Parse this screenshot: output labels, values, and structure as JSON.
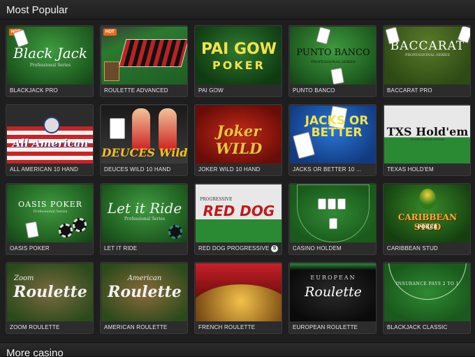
{
  "sections": {
    "most_popular": "Most Popular",
    "more_casino": "More casino"
  },
  "badges": {
    "hot": "HOT",
    "s": "S"
  },
  "games": [
    {
      "label": "BLACKJACK PRO",
      "logo": "Black Jack",
      "sub": "Professional Series"
    },
    {
      "label": "ROULETTE ADVANCED",
      "logo": "",
      "sub": ""
    },
    {
      "label": "PAI GOW",
      "logo": "PAI GOW",
      "sub": "POKER"
    },
    {
      "label": "PUNTO BANCO",
      "logo": "PUNTO BANCO",
      "sub": "PROFESSIONAL SERIES"
    },
    {
      "label": "BACCARAT PRO",
      "logo": "BACCARAT",
      "sub": "PROFESSIONAL SERIES"
    },
    {
      "label": "ALL AMERICAN 10 HAND",
      "logo": "All American",
      "sub": "100 Hand"
    },
    {
      "label": "DEUCES WILD 10 HAND",
      "logo": "DEUCES Wild",
      "sub": ""
    },
    {
      "label": "JOKER WILD 10 HAND",
      "logo": "Joker WILD",
      "sub": ""
    },
    {
      "label": "JACKS OR BETTER 10 ...",
      "logo": "JACKS OR BETTER",
      "sub": ""
    },
    {
      "label": "TEXAS HOLD'EM",
      "logo": "TXS Hold'em",
      "sub": "Professional Series"
    },
    {
      "label": "OASIS POKER",
      "logo": "OASIS POKER",
      "sub": "Professional Series"
    },
    {
      "label": "LET IT RIDE",
      "logo": "Let it Ride",
      "sub": "Professional Series"
    },
    {
      "label": "RED DOG PROGRESSIVE",
      "logo": "RED DOG",
      "sub": "PROGRESSIVE"
    },
    {
      "label": "CASINO HOLDEM",
      "logo": "",
      "sub": ""
    },
    {
      "label": "CARIBBEAN STUD",
      "logo": "CARIBBEAN STUD",
      "sub": "POKER"
    },
    {
      "label": "ZOOM ROULETTE",
      "logo": "Roulette",
      "sub": "Zoom"
    },
    {
      "label": "AMERICAN ROULETTE",
      "logo": "Roulette",
      "sub": "American"
    },
    {
      "label": "FRENCH ROULETTE",
      "logo": "",
      "sub": ""
    },
    {
      "label": "EUROPEAN ROULETTE",
      "logo": "Roulette",
      "sub": "EUROPEAN"
    },
    {
      "label": "BLACKJACK CLASSIC",
      "logo": "",
      "sub": "INSURANCE PAYS 2 TO 1"
    }
  ]
}
